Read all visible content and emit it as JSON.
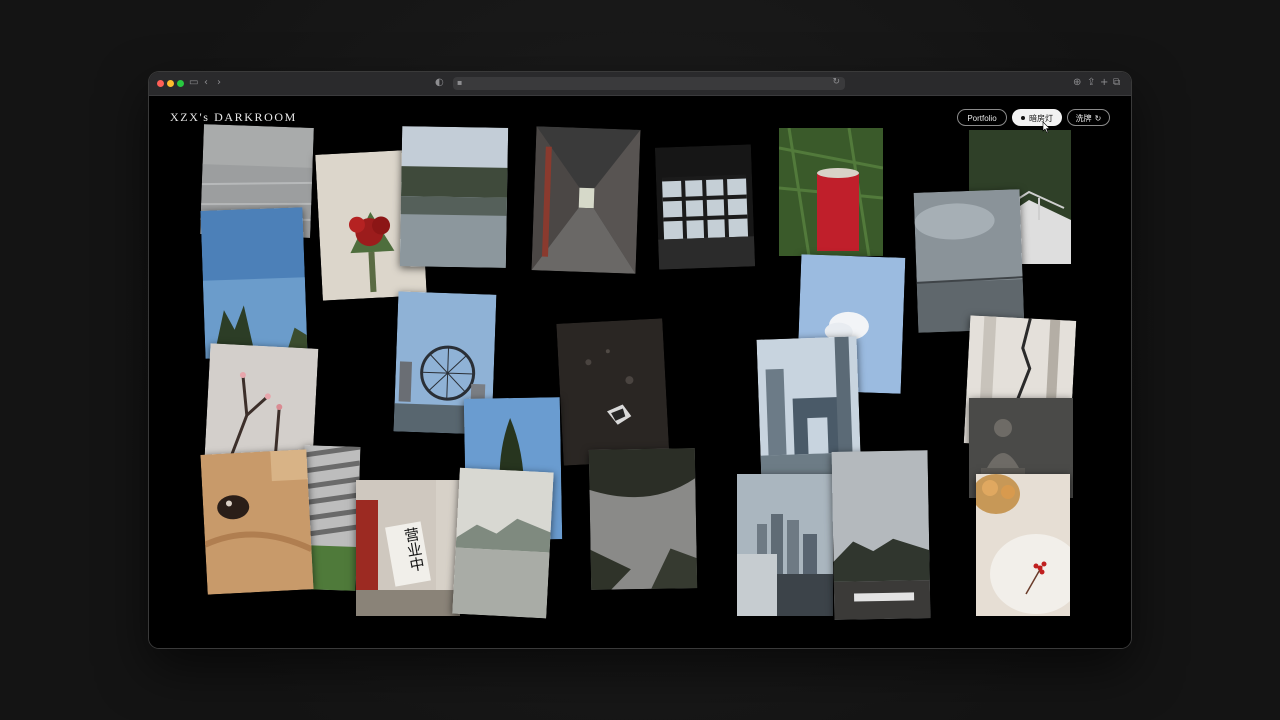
{
  "site": {
    "logo": "XZX's DARKROOM"
  },
  "nav": {
    "portfolio": "Portfolio",
    "darkroom": "暗房灯",
    "shuffle": "洗牌",
    "shuffle_icon": "refresh-icon"
  },
  "colors": {
    "background": "#000000",
    "text": "#e8e8e8",
    "active_button": "#f2f2f2"
  },
  "photos": [
    {
      "subject": "river-water"
    },
    {
      "subject": "red-flowers-vase"
    },
    {
      "subject": "lake-reflection"
    },
    {
      "subject": "arcade-corridor"
    },
    {
      "subject": "window-frames"
    },
    {
      "subject": "red-candle-grass"
    },
    {
      "subject": "railing-trees"
    },
    {
      "subject": "blue-sky-tree"
    },
    {
      "subject": "grey-sky-sea"
    },
    {
      "subject": "ferris-wheel"
    },
    {
      "subject": "dark-ground"
    },
    {
      "subject": "cloud-blue-sky"
    },
    {
      "subject": "city-towers"
    },
    {
      "subject": "wall-crack"
    },
    {
      "subject": "blossom-branch"
    },
    {
      "subject": "buddha-statue"
    },
    {
      "subject": "rabbit-closeup"
    },
    {
      "subject": "striped-roof"
    },
    {
      "subject": "shop-sign"
    },
    {
      "subject": "cypress-tree"
    },
    {
      "subject": "misty-lake"
    },
    {
      "subject": "dark-branches"
    },
    {
      "subject": "city-skyline"
    },
    {
      "subject": "cloudy-sky"
    },
    {
      "subject": "plate-berries"
    }
  ],
  "sign_text": "营业中"
}
